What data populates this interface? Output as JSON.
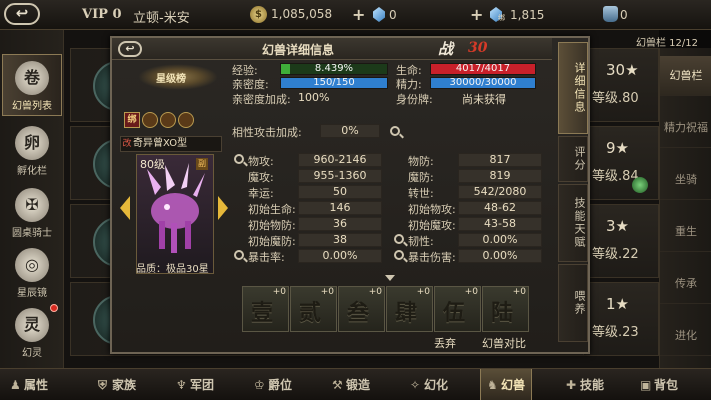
{
  "topbar": {
    "back_label": "↩",
    "vip": "VIP 0",
    "player_name": "立顿-米安",
    "coins": "1,085,058",
    "gems": "0",
    "bound_gems_tag": "绑",
    "bound_gems": "1,815",
    "bag": "0"
  },
  "pets_count": "幻兽栏 12/12",
  "sidebar": {
    "items": [
      {
        "label": "幻兽列表",
        "icon": "卷"
      },
      {
        "label": "孵化栏",
        "icon": "卵"
      },
      {
        "label": "圆桌骑士",
        "icon": "✠"
      },
      {
        "label": "星辰镜",
        "icon": "◎"
      },
      {
        "label": "幻灵",
        "icon": "灵"
      }
    ]
  },
  "right_list": [
    {
      "stars": "30★",
      "level": "等级.80"
    },
    {
      "stars": "9★",
      "level": "等级.84"
    },
    {
      "stars": "3★",
      "level": "等级.22"
    },
    {
      "stars": "1★",
      "level": "等级.23"
    }
  ],
  "right_sidebar": {
    "items": [
      "幻兽栏",
      "精力祝福",
      "坐骑",
      "重生",
      "传承",
      "进化"
    ]
  },
  "bottombar": {
    "items": [
      "属性",
      "家族",
      "军团",
      "爵位",
      "锻造",
      "幻化",
      "幻兽",
      "技能",
      "背包"
    ]
  },
  "dialog": {
    "back_label": "↩",
    "title": "幻兽详细信息",
    "combat_label": "战",
    "combat_value": "30",
    "grade_emblem": "星级榜",
    "skill_tag": "绑",
    "pet_name_tag": "改",
    "pet_name": "奇异曾XO型",
    "pet_level": "80级",
    "pet_badge": "副",
    "pet_quality": "品质：极品30星",
    "tabs": [
      "详细信息",
      "评分",
      "技能天赋",
      "喂养"
    ],
    "top_stats": {
      "exp_label": "经验:",
      "exp_value": "8.439%",
      "exp_fraction": 0.0844,
      "life_label": "生命:",
      "life_value": "4017/4017",
      "life_fraction": 1.0,
      "intimacy_label": "亲密度:",
      "intimacy_value": "150/150",
      "intimacy_fraction": 1.0,
      "energy_label": "精力:",
      "energy_value": "30000/30000",
      "energy_fraction": 1.0,
      "intimacy_bonus_label": "亲密度加成:",
      "intimacy_bonus_value": "100%",
      "identity_label": "身份牌:",
      "identity_value": "尚未获得"
    },
    "affinity_label": "相性攻击加成:",
    "affinity_value": "0%",
    "left_stats": [
      {
        "label": "物攻:",
        "value": "960-2146"
      },
      {
        "label": "魔攻:",
        "value": "955-1360"
      },
      {
        "label": "幸运:",
        "value": "50"
      },
      {
        "label": "初始生命:",
        "value": "146"
      },
      {
        "label": "初始物防:",
        "value": "36"
      },
      {
        "label": "初始魔防:",
        "value": "38"
      },
      {
        "label": "暴击率:",
        "value": "0.00%"
      }
    ],
    "right_stats": [
      {
        "label": "物防:",
        "value": "817"
      },
      {
        "label": "魔防:",
        "value": "819"
      },
      {
        "label": "转世:",
        "value": "542/2080"
      },
      {
        "label": "初始物攻:",
        "value": "48-62"
      },
      {
        "label": "初始魔攻:",
        "value": "43-58"
      },
      {
        "label": "韧性:",
        "value": "0.00%"
      },
      {
        "label": "暴击伤害:",
        "value": "0.00%"
      }
    ],
    "slots": [
      {
        "char": "壹",
        "plus": "+0"
      },
      {
        "char": "贰",
        "plus": "+0"
      },
      {
        "char": "叁",
        "plus": "+0"
      },
      {
        "char": "肆",
        "plus": "+0"
      },
      {
        "char": "伍",
        "plus": "+0"
      },
      {
        "char": "陆",
        "plus": "+0"
      }
    ],
    "discard_label": "丢弃",
    "compare_label": "幻兽对比"
  },
  "colors": {
    "exp_bar": "#3fae3a",
    "life_bar": "#c8202a",
    "intimacy_bar": "#2f7fcf",
    "energy_bar": "#2f7fcf",
    "combat_value": "#d63a28"
  }
}
